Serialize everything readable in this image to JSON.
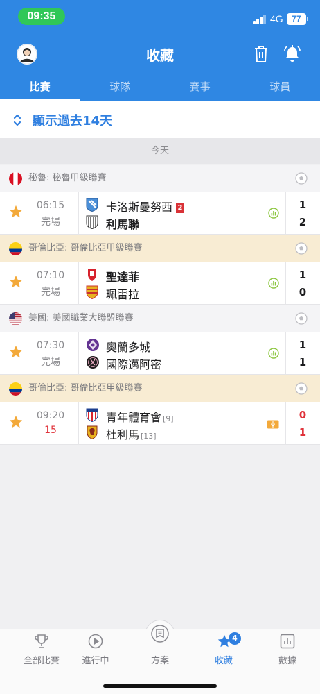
{
  "status_bar": {
    "time": "09:35",
    "network": "4G",
    "battery": "77"
  },
  "header": {
    "title": "收藏"
  },
  "tabs": [
    {
      "label": "比賽",
      "active": true
    },
    {
      "label": "球隊",
      "active": false
    },
    {
      "label": "賽事",
      "active": false
    },
    {
      "label": "球員",
      "active": false
    }
  ],
  "period_filter": {
    "label": "顯示過去14天"
  },
  "date_header": "今天",
  "leagues": [
    {
      "name": "秘魯: 秘魯甲級聯賽",
      "flag": "peru",
      "highlighted": false,
      "match": {
        "time": "06:15",
        "status": "完場",
        "home": {
          "name": "卡洛斯曼努西",
          "red_cards": "2",
          "rank": ""
        },
        "away": {
          "name": "利馬聯",
          "rank": ""
        },
        "home_score": "1",
        "away_score": "2",
        "icon": "stats-icon"
      }
    },
    {
      "name": "哥倫比亞: 哥倫比亞甲級聯賽",
      "flag": "colombia",
      "highlighted": true,
      "match": {
        "time": "07:10",
        "status": "完場",
        "home": {
          "name": "聖達菲",
          "rank": ""
        },
        "away": {
          "name": "珮雷拉",
          "rank": ""
        },
        "home_score": "1",
        "away_score": "0",
        "icon": "stats-icon"
      }
    },
    {
      "name": "美國: 美國職業大聯盟聯賽",
      "flag": "usa",
      "highlighted": false,
      "match": {
        "time": "07:30",
        "status": "完場",
        "home": {
          "name": "奧蘭多城",
          "rank": ""
        },
        "away": {
          "name": "國際邁阿密",
          "rank": ""
        },
        "home_score": "1",
        "away_score": "1",
        "icon": "stats-icon"
      }
    },
    {
      "name": "哥倫比亞: 哥倫比亞甲級聯賽",
      "flag": "colombia",
      "highlighted": true,
      "match": {
        "time": "09:20",
        "status": "15",
        "home": {
          "name": "青年體育會",
          "rank": "[9]"
        },
        "away": {
          "name": "杜利馬",
          "rank": "[13]"
        },
        "home_score": "0",
        "away_score": "1",
        "live": true,
        "icon": "pitch-icon"
      }
    }
  ],
  "bottom_tabs": [
    {
      "label": "全部比賽",
      "icon": "trophy-icon"
    },
    {
      "label": "進行中",
      "icon": "play-icon"
    },
    {
      "label": "方案",
      "icon": "plan-icon"
    },
    {
      "label": "收藏",
      "icon": "star-icon",
      "active": true,
      "badge": "4"
    },
    {
      "label": "數據",
      "icon": "chart-icon"
    }
  ],
  "colors": {
    "primary": "#2f87e3",
    "accent_text": "#2f7fe0",
    "live_red": "#e0323a",
    "star": "#f3a93a",
    "stats_green": "#8cc63f"
  }
}
